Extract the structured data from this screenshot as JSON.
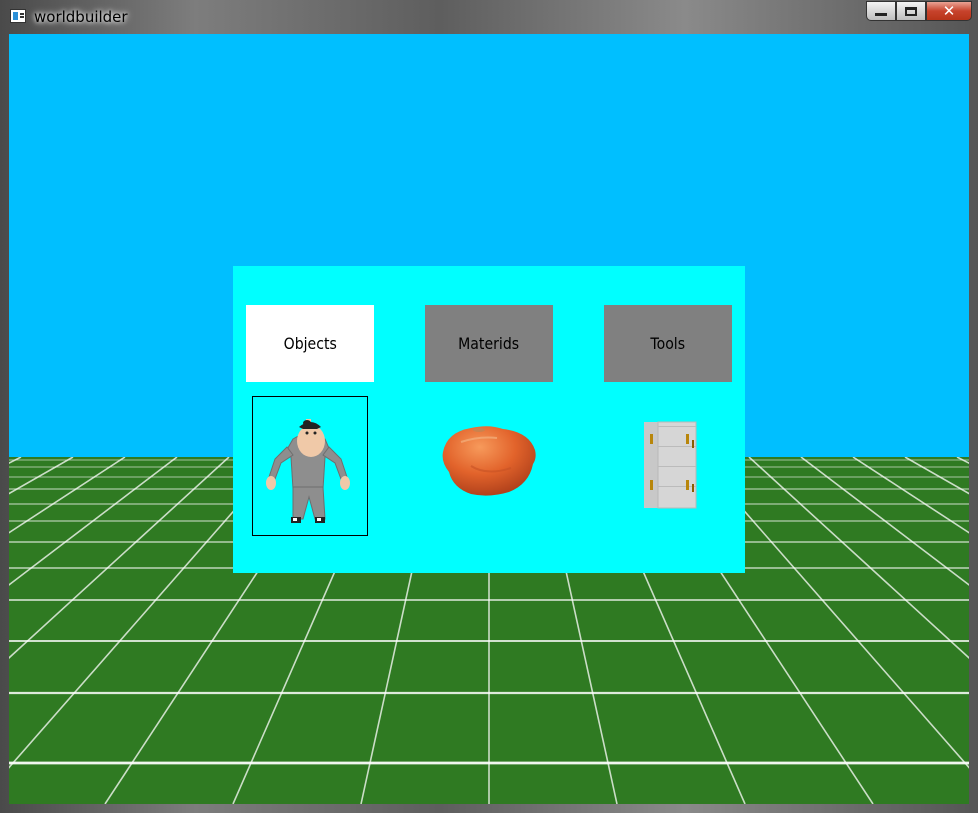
{
  "window": {
    "title": "worldbuilder",
    "controls": {
      "minimize": "minimize",
      "maximize": "maximize",
      "close": "close"
    }
  },
  "colors": {
    "sky": "#00bfff",
    "ground": "#2f7a22",
    "grid_line": "#ffffff",
    "panel": "#00ffff",
    "tab_active": "#ffffff",
    "tab_inactive": "#808080"
  },
  "menu": {
    "tabs": [
      {
        "label": "Objects",
        "active": true
      },
      {
        "label": "Materids",
        "active": false
      },
      {
        "label": "Tools",
        "active": false
      }
    ],
    "items": [
      {
        "icon": "character-figure-icon",
        "selected": true
      },
      {
        "icon": "orange-ball-icon",
        "selected": false
      },
      {
        "icon": "building-block-icon",
        "selected": false
      }
    ]
  }
}
